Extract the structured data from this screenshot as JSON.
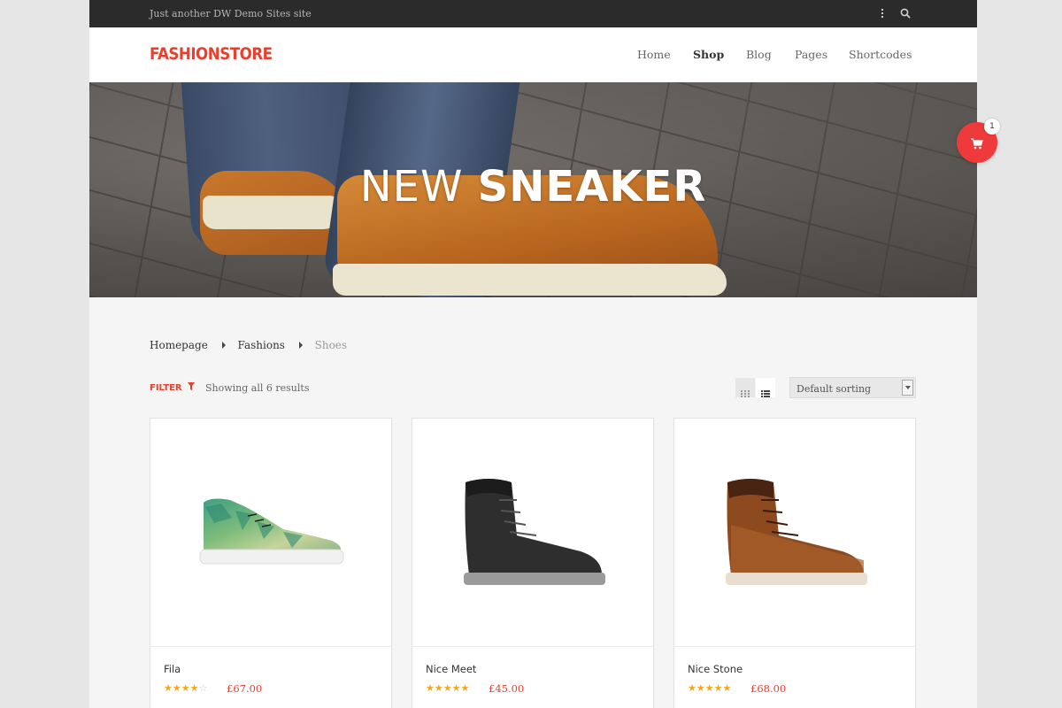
{
  "topbar": {
    "tagline": "Just another DW Demo Sites site"
  },
  "header": {
    "logo": "FASHIONSTORE",
    "nav": [
      {
        "label": "Home",
        "active": false
      },
      {
        "label": "Shop",
        "active": true
      },
      {
        "label": "Blog",
        "active": false
      },
      {
        "label": "Pages",
        "active": false
      },
      {
        "label": "Shortcodes",
        "active": false
      }
    ]
  },
  "hero": {
    "title_light": "NEW",
    "title_bold": "SNEAKER"
  },
  "cart": {
    "count": "1"
  },
  "breadcrumb": {
    "items": [
      "Homepage",
      "Fashions",
      "Shoes"
    ]
  },
  "toolbar": {
    "filter_label": "FILTER",
    "results_text": "Showing all 6 results",
    "sorting": "Default sorting"
  },
  "products": [
    {
      "name": "Fila",
      "rating": 4,
      "max_rating": 5,
      "price": "£67.00"
    },
    {
      "name": "Nice Meet",
      "rating": 5,
      "max_rating": 5,
      "price": "£45.00"
    },
    {
      "name": "Nice Stone",
      "rating": 5,
      "max_rating": 5,
      "price": "£68.00"
    }
  ],
  "colors": {
    "accent": "#e8402f",
    "topbar": "#2b2b2b",
    "star": "#f2a81d"
  }
}
